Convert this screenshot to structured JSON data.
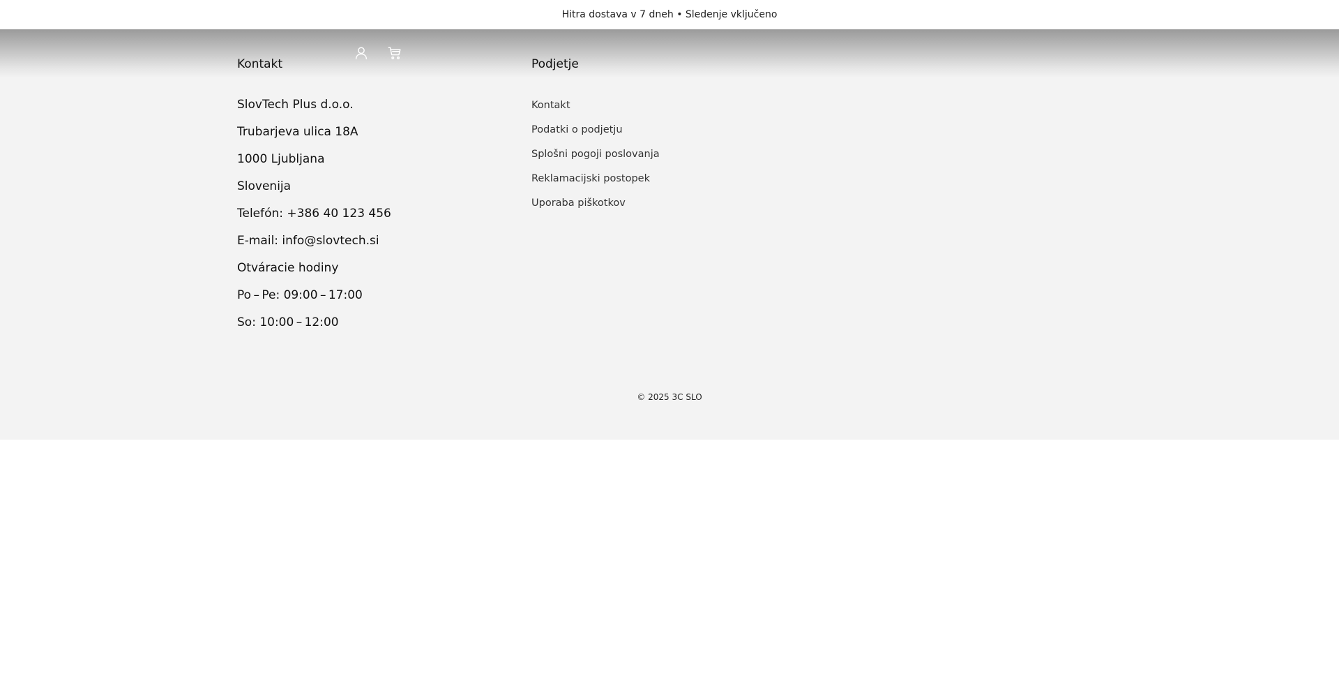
{
  "announcement": {
    "text": "Hitra dostava v 7 dneh • Sledenje vključeno"
  },
  "header": {
    "icons": [
      "user-icon",
      "cart-icon"
    ]
  },
  "footer": {
    "contact": {
      "heading": "Kontakt",
      "lines": [
        "SlovTech Plus d.o.o.",
        "Trubarjeva ulica 18A",
        "1000 Ljubljana",
        "Slovenija",
        "Telefón: +386 40 123 456",
        "E-mail: info@slovtech.si",
        "Otváracie hodiny",
        "Po – Pe: 09:00 – 17:00",
        "So: 10:00 – 12:00"
      ]
    },
    "company": {
      "heading": "Podjetje",
      "links": [
        "Kontakt",
        "Podatki o podjetju",
        "Splošni pogoji poslovanja",
        "Reklamacijski postopek",
        "Uporaba piškotkov"
      ]
    },
    "copyright": "© 2025 3C SLO"
  },
  "colors": {
    "footer_bg": "#f3f3f3",
    "header_shade": "#9a9a9a",
    "text": "#111111"
  }
}
